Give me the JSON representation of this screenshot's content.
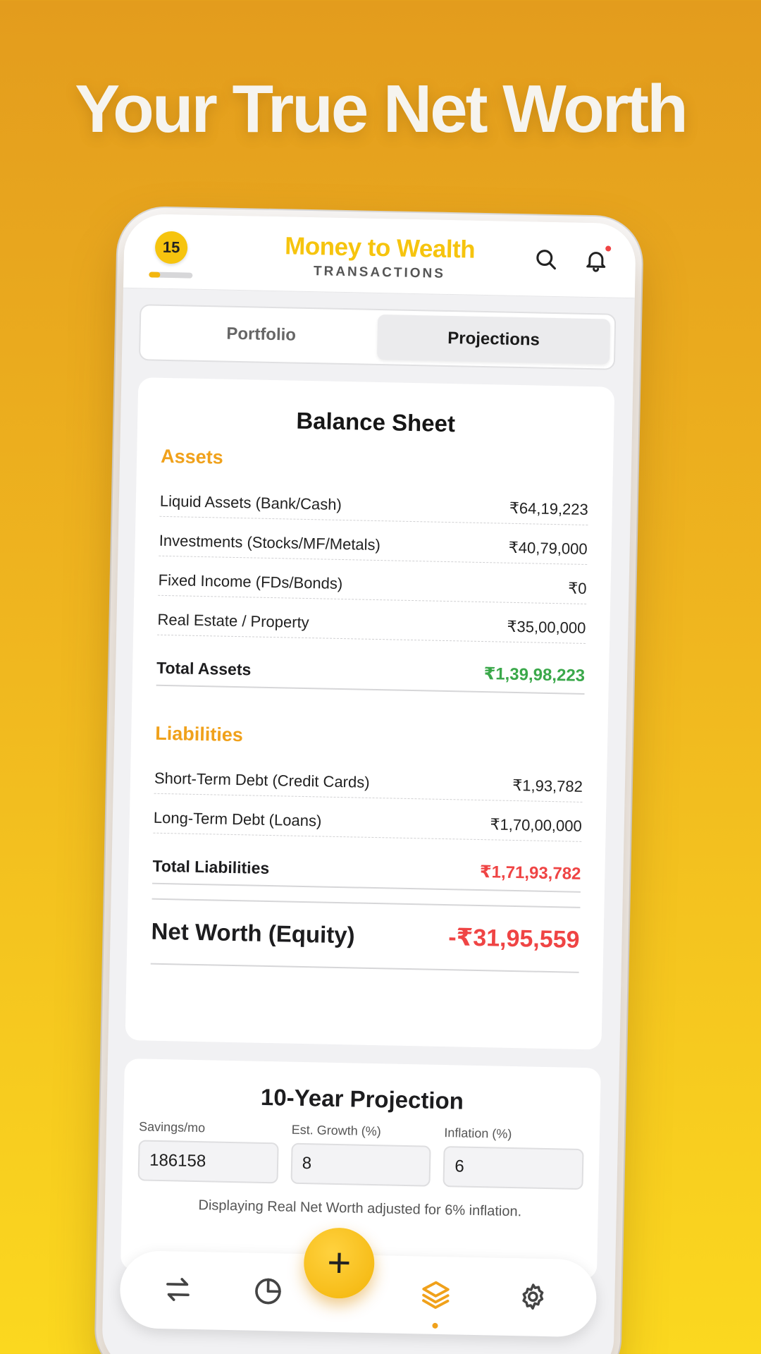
{
  "headline": "Your True Net Worth",
  "app": {
    "level": "15",
    "level_progress": 0.25,
    "brand_title": "Money to Wealth",
    "brand_subtitle": "TRANSACTIONS"
  },
  "tabs": [
    {
      "label": "Portfolio",
      "active": false
    },
    {
      "label": "Projections",
      "active": true
    }
  ],
  "balance_sheet": {
    "title": "Balance Sheet",
    "assets_title": "Assets",
    "assets": [
      {
        "label": "Liquid Assets (Bank/Cash)",
        "value": "₹64,19,223"
      },
      {
        "label": "Investments (Stocks/MF/Metals)",
        "value": "₹40,79,000"
      },
      {
        "label": "Fixed Income (FDs/Bonds)",
        "value": "₹0"
      },
      {
        "label": "Real Estate / Property",
        "value": "₹35,00,000"
      }
    ],
    "total_assets_label": "Total Assets",
    "total_assets_value": "₹1,39,98,223",
    "liabilities_title": "Liabilities",
    "liabilities": [
      {
        "label": "Short-Term Debt (Credit Cards)",
        "value": "₹1,93,782"
      },
      {
        "label": "Long-Term Debt (Loans)",
        "value": "₹1,70,00,000"
      }
    ],
    "total_liabilities_label": "Total Liabilities",
    "total_liabilities_value": "₹1,71,93,782",
    "net_worth_label": "Net Worth (Equity)",
    "net_worth_value": "-₹31,95,559"
  },
  "projection": {
    "title": "10-Year Projection",
    "fields": [
      {
        "label": "Savings/mo",
        "value": "186158"
      },
      {
        "label": "Est. Growth (%)",
        "value": "8"
      },
      {
        "label": "Inflation (%)",
        "value": "6"
      }
    ],
    "note": "Displaying Real Net Worth adjusted for 6% inflation."
  },
  "nav": {
    "fab_label": "+",
    "items": [
      "transfer-icon",
      "pie-chart-icon",
      "layers-icon",
      "settings-icon"
    ],
    "active": "layers-icon"
  },
  "colors": {
    "accent": "#f6c40e",
    "section": "#f0a11b",
    "positive": "#3aa84a",
    "negative": "#ef4444"
  }
}
